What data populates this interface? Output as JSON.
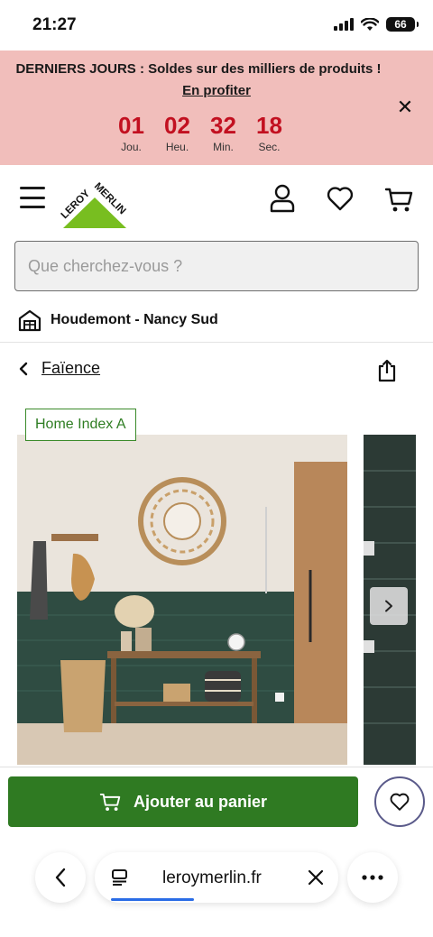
{
  "status_bar": {
    "time": "21:27",
    "battery": "66"
  },
  "promo": {
    "title": "DERNIERS JOURS : Soldes sur des milliers de produits !",
    "link": "En profiter",
    "countdown": [
      {
        "value": "01",
        "unit": "Jou."
      },
      {
        "value": "02",
        "unit": "Heu."
      },
      {
        "value": "32",
        "unit": "Min."
      },
      {
        "value": "18",
        "unit": "Sec."
      }
    ]
  },
  "logo": {
    "text": "LEROY MERLIN",
    "color": "#78be20"
  },
  "search": {
    "placeholder": "Que cherchez-vous ?"
  },
  "store": {
    "name": "Houdemont - Nancy Sud"
  },
  "breadcrumb": {
    "label": "Faïence"
  },
  "product": {
    "badge": "Home Index A"
  },
  "cta": {
    "add_to_cart": "Ajouter au panier",
    "color": "#2f7a22"
  },
  "browser": {
    "url": "leroymerlin.fr"
  },
  "colors": {
    "banner_bg": "#f1bebb",
    "countdown": "#c21020",
    "brand_green": "#78be20"
  }
}
